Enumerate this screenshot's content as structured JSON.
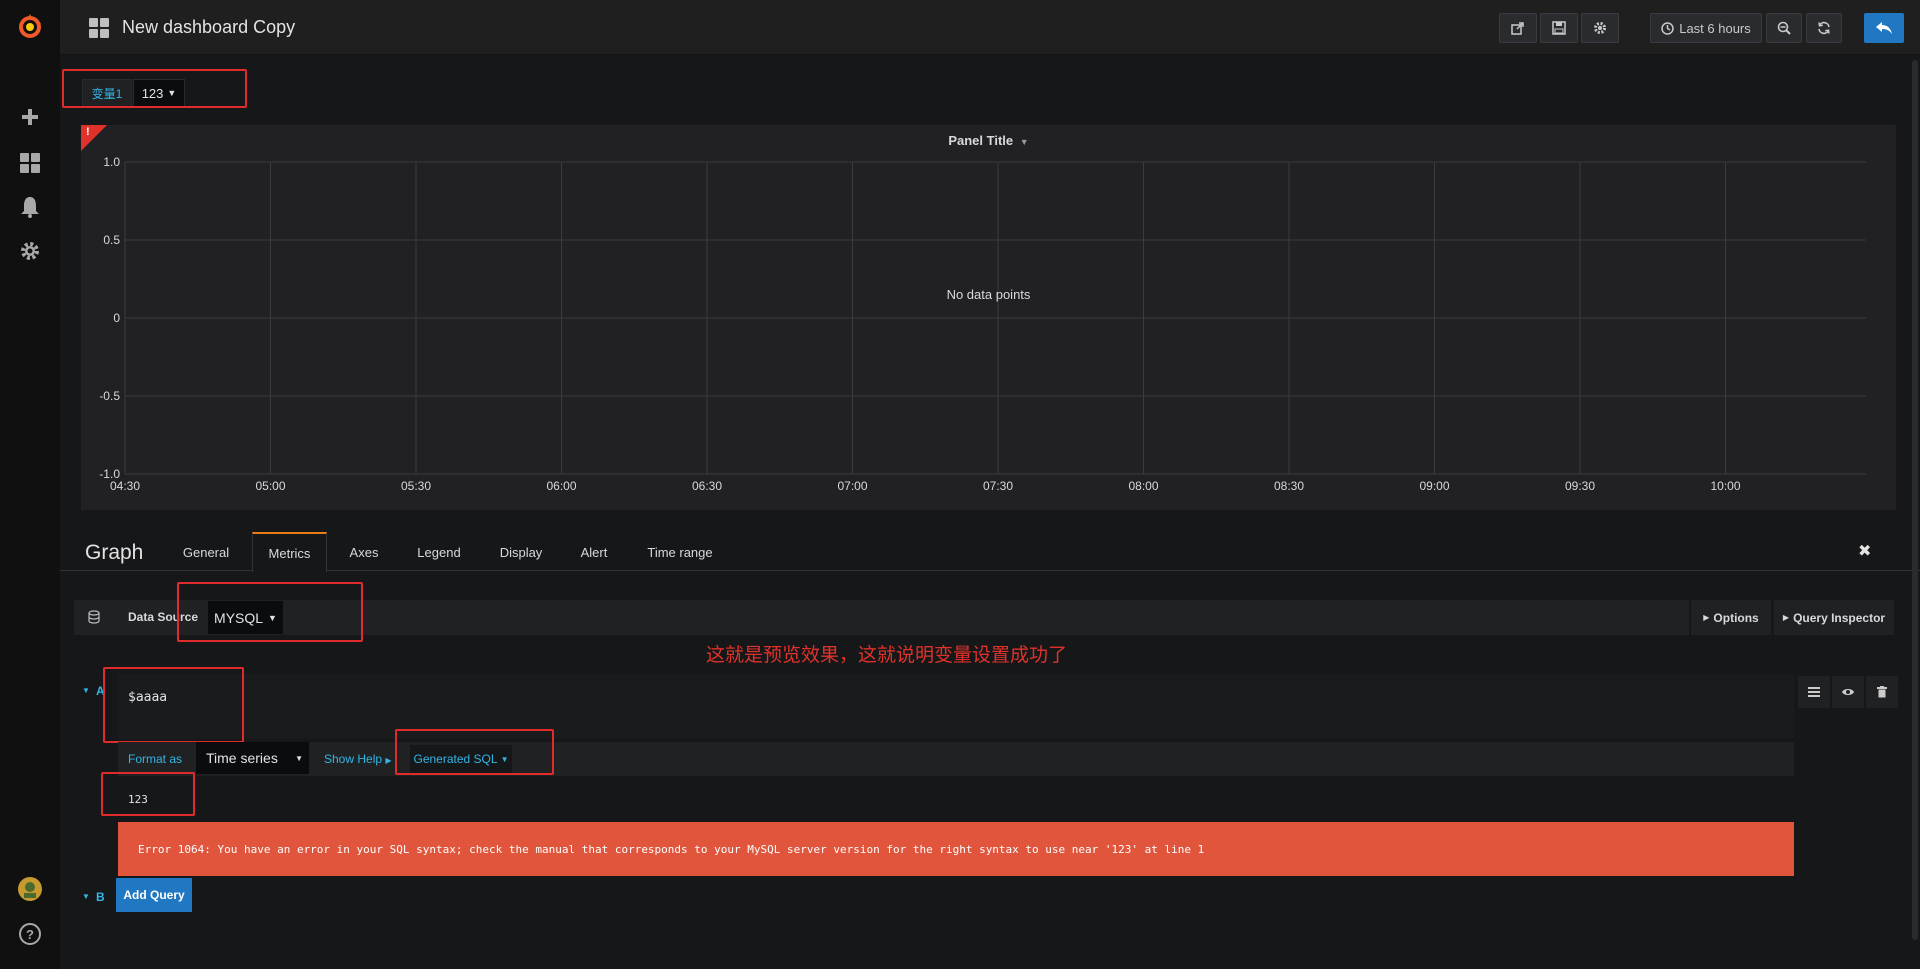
{
  "topbar": {
    "title": "New dashboard Copy",
    "time_range": "Last 6 hours",
    "buttons": [
      "share-icon",
      "save-icon",
      "settings-icon",
      "zoom-out-icon",
      "refresh-icon",
      "back-icon"
    ]
  },
  "sidebar": {
    "items": [
      "grafana-logo",
      "plus-icon",
      "dashboards-icon",
      "alert-bell-icon",
      "gear-icon",
      "avatar",
      "help-icon"
    ],
    "help_label": "?"
  },
  "variables": {
    "label": "变量1",
    "value": "123"
  },
  "panel": {
    "title": "Panel Title",
    "error_marker": "!",
    "no_data": "No data points",
    "y_ticks": [
      "1.0",
      "0.5",
      "0",
      "-0.5",
      "-1.0"
    ],
    "x_ticks": [
      "04:30",
      "05:00",
      "05:30",
      "06:00",
      "06:30",
      "07:00",
      "07:30",
      "08:00",
      "08:30",
      "09:00",
      "09:30",
      "10:00"
    ]
  },
  "editor": {
    "title": "Graph",
    "tabs": [
      "General",
      "Metrics",
      "Axes",
      "Legend",
      "Display",
      "Alert",
      "Time range"
    ],
    "active_tab": "Metrics",
    "close": "✖"
  },
  "datasource": {
    "label": "Data Source",
    "value": "MYSQL",
    "options_label": "Options",
    "inspector_label": "Query Inspector"
  },
  "annotation": "这就是预览效果，这就说明变量设置成功了",
  "query_a": {
    "ref": "A",
    "text": "$aaaa",
    "format_label": "Format as",
    "format_value": "Time series",
    "show_help": "Show Help",
    "generated_sql": "Generated SQL",
    "sql_preview": "123",
    "error": "Error 1064: You have an error in your SQL syntax; check the manual that corresponds to your MySQL server version for the right syntax to use near '123' at line 1"
  },
  "query_b": {
    "ref": "B",
    "add_label": "Add Query"
  },
  "colors": {
    "accent_blue": "#33b5e5",
    "error_bg": "#e0553c",
    "annotation_red": "#e0322b",
    "active_tab_border": "#eb7b18",
    "primary_btn": "#1f78c1"
  }
}
